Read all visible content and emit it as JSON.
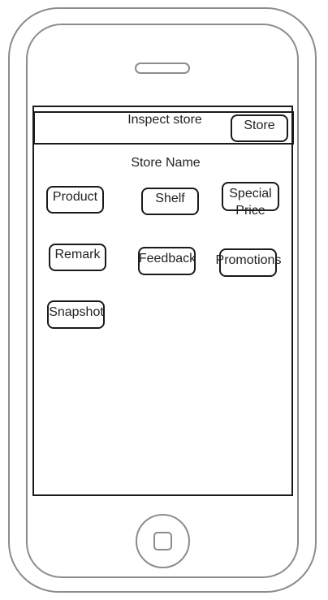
{
  "header": {
    "title": "Inspect store",
    "store_button": "Store"
  },
  "store_name": "Store Name",
  "buttons": {
    "product": "Product",
    "shelf": "Shelf",
    "special_price_line1": "Special",
    "special_price_line2": "Price",
    "remark": "Remark",
    "feedback": "Feedback",
    "promotions": "Promotions",
    "snapshot": "Snapshot"
  }
}
